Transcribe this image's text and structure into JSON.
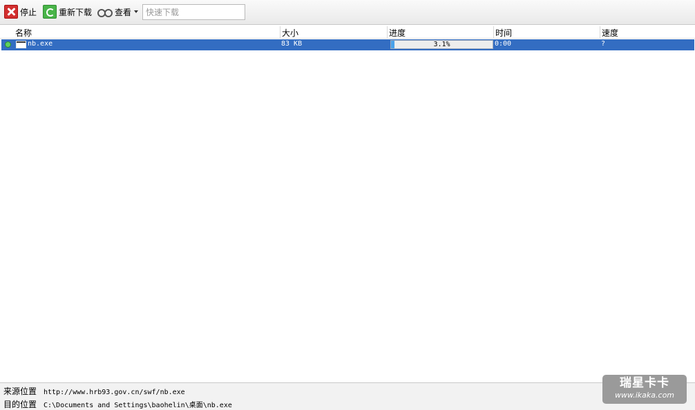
{
  "toolbar": {
    "stop_label": "停止",
    "redownload_label": "重新下载",
    "view_label": "查看",
    "search": {
      "value": "",
      "placeholder": "快速下载"
    }
  },
  "columns": {
    "name": "名称",
    "size": "大小",
    "progress": "进度",
    "time": "时间",
    "speed": "速度"
  },
  "downloads": [
    {
      "name": "nb.exe",
      "size": "83 KB",
      "progress_text": "3.1%",
      "progress_fraction": 0.031,
      "time": "0:00",
      "speed": "?"
    }
  ],
  "info": {
    "source_label": "来源位置",
    "source_value": "http://www.hrb93.gov.cn/swf/nb.exe",
    "dest_label": "目的位置",
    "dest_value": "C:\\Documents and Settings\\baohelin\\桌面\\nb.exe"
  },
  "watermark": {
    "line1": "瑞星卡卡",
    "line2": "www.ikaka.com"
  },
  "colors": {
    "selected_row": "#336dc2",
    "progress_fill": "#4aa2ea"
  }
}
